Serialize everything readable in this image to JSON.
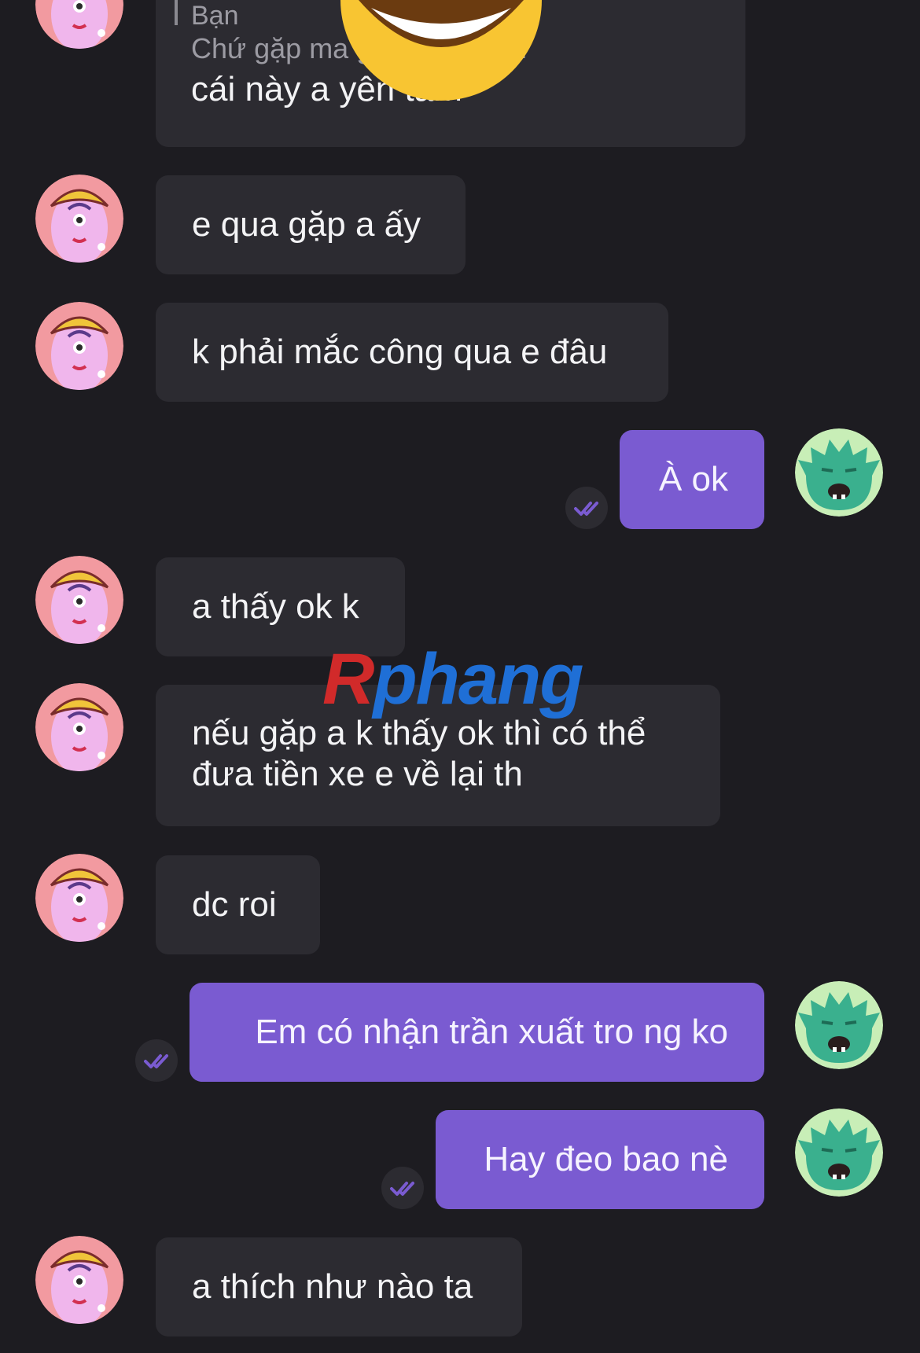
{
  "messages": [
    {
      "text": "e qua gặp a ấy"
    },
    {
      "text": "k phải mắc công qua e đâu"
    },
    {
      "text": "À ok"
    },
    {
      "text": "a thấy ok k"
    },
    {
      "text": "nếu gặp a k thấy ok thì có thể đưa tiền xe e về lại th"
    },
    {
      "text": "dc roi"
    },
    {
      "text": "Em có nhận trần xuất tro ng ko"
    },
    {
      "text": "Hay đeo bao nè"
    },
    {
      "text": "a thích như nào ta"
    }
  ],
  "reply": {
    "sender": "Bạn",
    "quoted_text": "Chứ gặp ma                      g đợi mắc c...",
    "message": "cái này a yên tâm"
  },
  "watermark": {
    "part1": "R",
    "part2": "phang"
  },
  "icons": {
    "incoming_avatar": "pink-one-eyed-monster-avatar",
    "outgoing_avatar": "green-furry-monster-avatar",
    "read_receipt": "double-check-icon",
    "sticker": "grinning-emoji"
  },
  "colors": {
    "background": "#1d1c21",
    "incoming_bubble": "#2c2b31",
    "outgoing_bubble": "#7a5bd1",
    "read_receipt": "#7a5bd1"
  }
}
